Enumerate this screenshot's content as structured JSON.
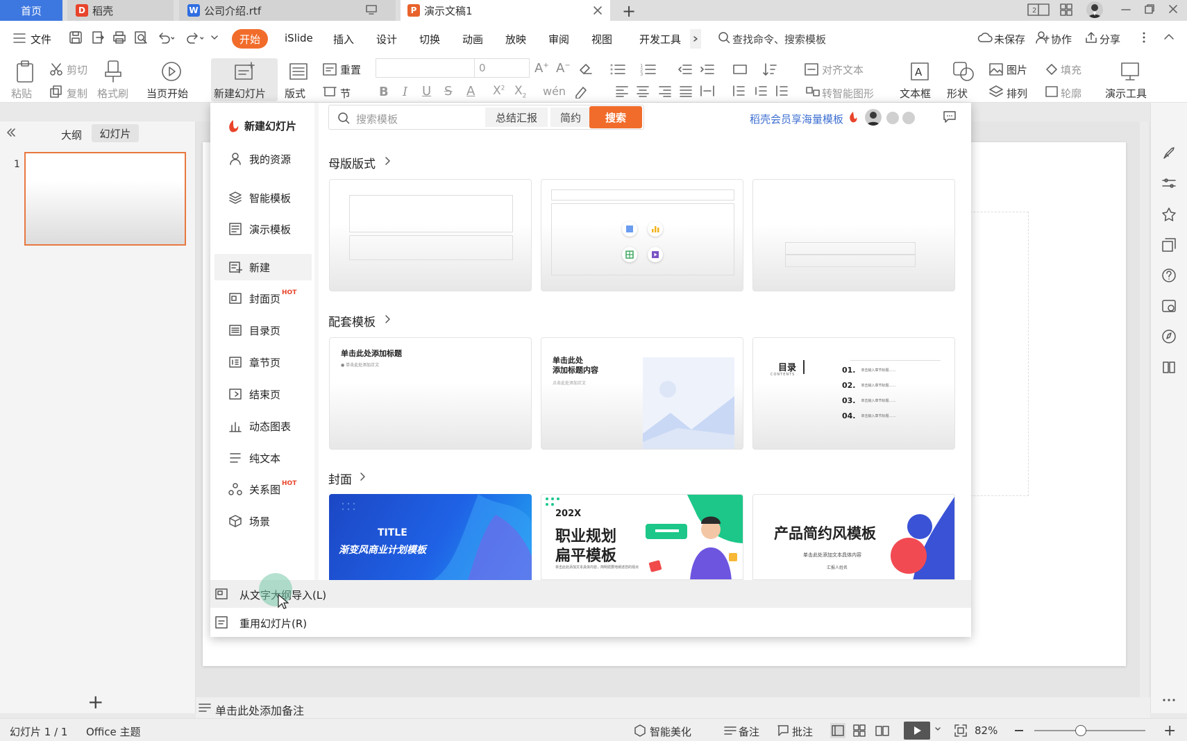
{
  "tabs": {
    "home": "首页",
    "daoke": "稻壳",
    "file": "公司介绍.rtf",
    "active": "演示文稿1",
    "new_tab": "+"
  },
  "menu": {
    "file": "文件",
    "items": [
      "开始",
      "iSlide",
      "插入",
      "设计",
      "切换",
      "动画",
      "放映",
      "审阅",
      "视图",
      "开发工具"
    ],
    "search": "查找命令、搜索模板",
    "unsaved": "未保存",
    "collab": "协作",
    "share": "分享"
  },
  "ribbon": {
    "paste": "粘贴",
    "cut": "剪切",
    "copy": "复制",
    "format_painter": "格式刷",
    "from_current": "当页开始",
    "new_slide": "新建幻灯片",
    "layout": "版式",
    "section": "节",
    "reset": "重置",
    "font_size": "0",
    "align_text": "对齐文本",
    "smart_shape": "转智能图形",
    "textbox": "文本框",
    "shape": "形状",
    "picture": "图片",
    "arrange": "排列",
    "fill": "填充",
    "outline": "轮廓",
    "present_tools": "演示工具"
  },
  "left_panel": {
    "outline_tab": "大纲",
    "slides_tab": "幻灯片",
    "slide_number": "1",
    "add": "+"
  },
  "popup": {
    "title": "新建幻灯片",
    "side_items": [
      {
        "label": "我的资源",
        "icon": "user-icon"
      },
      {
        "label": "智能模板",
        "icon": "layers-icon"
      },
      {
        "label": "演示模板",
        "icon": "template-icon"
      },
      {
        "label": "新建",
        "icon": "new-icon"
      },
      {
        "label": "封面页",
        "icon": "cover-icon",
        "hot": "HOT"
      },
      {
        "label": "目录页",
        "icon": "toc-icon"
      },
      {
        "label": "章节页",
        "icon": "chapter-icon"
      },
      {
        "label": "结束页",
        "icon": "end-icon"
      },
      {
        "label": "动态图表",
        "icon": "chart-icon"
      },
      {
        "label": "纯文本",
        "icon": "text-icon"
      },
      {
        "label": "关系图",
        "icon": "relation-icon",
        "hot": "HOT"
      },
      {
        "label": "场景",
        "icon": "scene-icon"
      }
    ],
    "search_placeholder": "搜索模板",
    "tag1": "总结汇报",
    "tag2": "简约",
    "search_btn": "搜索",
    "member_text": "稻壳会员享海量模板",
    "section1": "母版版式",
    "section2": "配套模板",
    "section3": "封面",
    "tpl_title_a": "单击此处添加标题",
    "tpl_text_a": "● 单击此处添加正文",
    "tpl_title_b1": "单击此处",
    "tpl_title_b2": "添加标题内容",
    "tpl_text_b": "点击此处添加正文",
    "toc_title": "目录",
    "toc_sub": "CONTENTS",
    "toc_items": [
      {
        "num": "01.",
        "text": "单击输入章节标题……"
      },
      {
        "num": "02.",
        "text": "单击输入章节标题……"
      },
      {
        "num": "03.",
        "text": "单击输入章节标题……"
      },
      {
        "num": "04.",
        "text": "单击输入章节标题……"
      }
    ],
    "cover1_title": "TITLE",
    "cover1_sub": "渐变风商业计划模板",
    "cover2_year": "202X",
    "cover2_line1": "职业规划",
    "cover2_line2": "扁平模板",
    "cover2_small": "单击此处添加文本具体内容，简明扼要地阐述您的观点",
    "cover3_title": "产品简约风模板",
    "cover3_sub": "单击此处添加文本具体内容",
    "cover3_reporter": "汇报人姓名",
    "import_outline": "从文字大纲导入(L)",
    "reuse_slides": "重用幻灯片(R)"
  },
  "notes": "单击此处添加备注",
  "status": {
    "slide_info": "幻灯片 1 / 1",
    "theme": "Office 主题",
    "beautify": "智能美化",
    "notes": "备注",
    "comments": "批注",
    "zoom": "82%"
  },
  "colors": {
    "accent": "#f16c2b",
    "home_tab": "#3d77e0",
    "link_blue": "#3d6fd1"
  }
}
